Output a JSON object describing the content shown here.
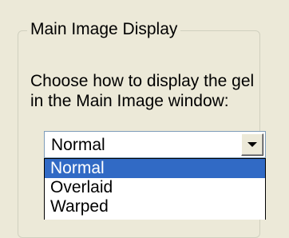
{
  "group": {
    "title": "Main Image Display",
    "description_lines": [
      "Choose how to display the gel",
      "in the Main Image window:"
    ]
  },
  "combobox": {
    "selected_value": "Normal",
    "button_icon": "chevron-down-icon"
  },
  "dropdown": {
    "items": [
      {
        "label": "Normal",
        "selected": true
      },
      {
        "label": "Overlaid",
        "selected": false
      },
      {
        "label": "Warped",
        "selected": false
      }
    ]
  },
  "colors": {
    "panel_background": "#ece9d8",
    "selection_background": "#316ac5",
    "selection_text": "#ffffff",
    "field_border": "#7f9db9"
  }
}
